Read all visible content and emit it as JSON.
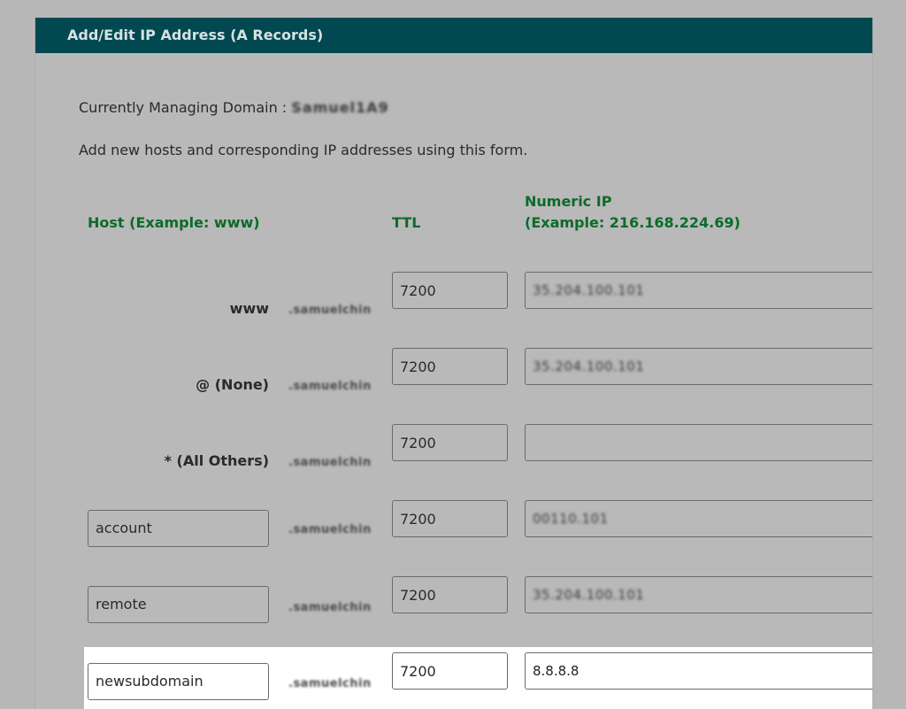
{
  "panel": {
    "title": "Add/Edit IP Address (A Records)"
  },
  "managing": {
    "label": "Currently Managing Domain :",
    "domain": "Samuel1A9"
  },
  "intro": "Add new hosts and corresponding IP addresses using this form.",
  "columns": {
    "host": "Host (Example: www)",
    "ttl": "TTL",
    "ip_line1": "Numeric IP",
    "ip_line2": "(Example: 216.168.224.69)"
  },
  "rows": [
    {
      "label": "www",
      "suffix": ".samuelchin",
      "ttl": "7200",
      "ip": "35.204.100.101"
    },
    {
      "label": "@ (None)",
      "suffix": ".samuelchin",
      "ttl": "7200",
      "ip": "35.204.100.101"
    },
    {
      "label": "* (All Others)",
      "suffix": ".samuelchin",
      "ttl": "7200",
      "ip": ""
    },
    {
      "host": "account",
      "suffix": ".samuelchin",
      "ttl": "7200",
      "ip": "00110.101"
    },
    {
      "host": "remote",
      "suffix": ".samuelchin",
      "ttl": "7200",
      "ip": "35.204.100.101"
    },
    {
      "host": "newsubdomain",
      "suffix": ".samuelchin",
      "ttl": "7200",
      "ip": "8.8.8.8"
    }
  ]
}
